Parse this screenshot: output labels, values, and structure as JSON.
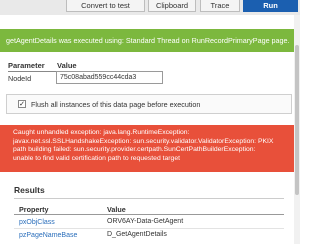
{
  "toolbar": {
    "convert_label": "Convert to test",
    "clipboard_label": "Clipboard",
    "trace_label": "Trace",
    "run_label": "Run"
  },
  "success_message": "getAgentDetails was executed using: Standard Thread on RunRecordPrimaryPage page.",
  "parameters": {
    "header_parameter": "Parameter",
    "header_value": "Value",
    "rows": [
      {
        "name": "NodeId",
        "value": "75c08abad559cc44cda3"
      }
    ]
  },
  "options": {
    "flush_label": "Flush all instances of this data page before execution",
    "flush_checked": true
  },
  "error": {
    "lines": [
      "Caught unhandled exception: java.lang.RuntimeException:",
      "javax.net.ssl.SSLHandshakeException: sun.security.validator.ValidatorException: PKIX",
      "path building failed: sun.security.provider.certpath.SunCertPathBuilderException:",
      "unable to find valid certification path to requested target"
    ]
  },
  "results": {
    "title": "Results",
    "header_property": "Property",
    "header_value": "Value",
    "rows": [
      {
        "property": "pxObjClass",
        "value": "ORV6AY-Data-GetAgent"
      },
      {
        "property": "pzPageNameBase",
        "value": "D_GetAgentDetails"
      }
    ]
  },
  "colors": {
    "success": "#7cb83e",
    "error": "#e8503a",
    "primary": "#1b5fb0",
    "link": "#2a6ebb"
  }
}
